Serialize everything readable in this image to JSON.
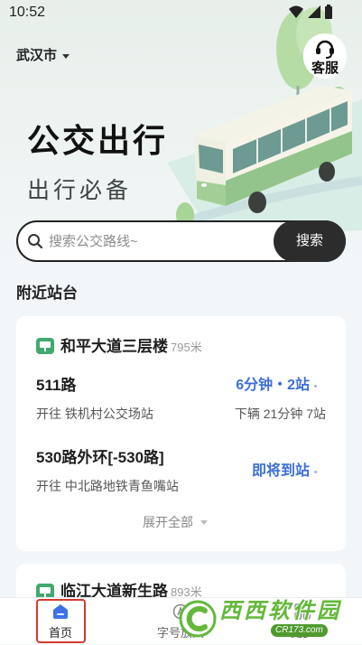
{
  "status_bar": {
    "time": "10:52",
    "icons": [
      "wifi-icon",
      "signal-icon",
      "battery-icon"
    ]
  },
  "header": {
    "city": "武汉市",
    "service_label": "客服",
    "service_icon": "headset-icon"
  },
  "hero": {
    "title": "公交出行",
    "subtitle": "出行必备"
  },
  "search": {
    "placeholder": "搜索公交路线~",
    "button_label": "搜索",
    "icon": "search-icon"
  },
  "nearby": {
    "section_title": "附近站台",
    "stations": [
      {
        "name": "和平大道三层楼",
        "distance": "795米",
        "routes": [
          {
            "route": "511路",
            "direction": "开往 铁机村公交场站",
            "eta": "6分钟・2站",
            "next": "下辆 21分钟 7站"
          },
          {
            "route": "530路外环[-530路]",
            "direction": "开往 中北路地铁青鱼嘴站",
            "eta": "即将到站"
          }
        ],
        "expand_label": "展开全部"
      },
      {
        "name": "临江大道新生路",
        "distance": "893米"
      }
    ]
  },
  "tabbar": {
    "active_index": 0,
    "items": [
      {
        "label": "首页",
        "icon": "home-icon"
      },
      {
        "label": "字号放大",
        "icon": "font-size-icon"
      },
      {
        "label": "更多",
        "icon": "more-icon"
      }
    ]
  },
  "watermark": {
    "brand": "西西软件园",
    "site": "CR173.com"
  },
  "colors": {
    "accent": "#3b6fd6",
    "search_button": "#2c2c2c",
    "station_icon": "#42a86e",
    "highlight_box": "#d23a2f",
    "watermark": "#63b83a"
  }
}
